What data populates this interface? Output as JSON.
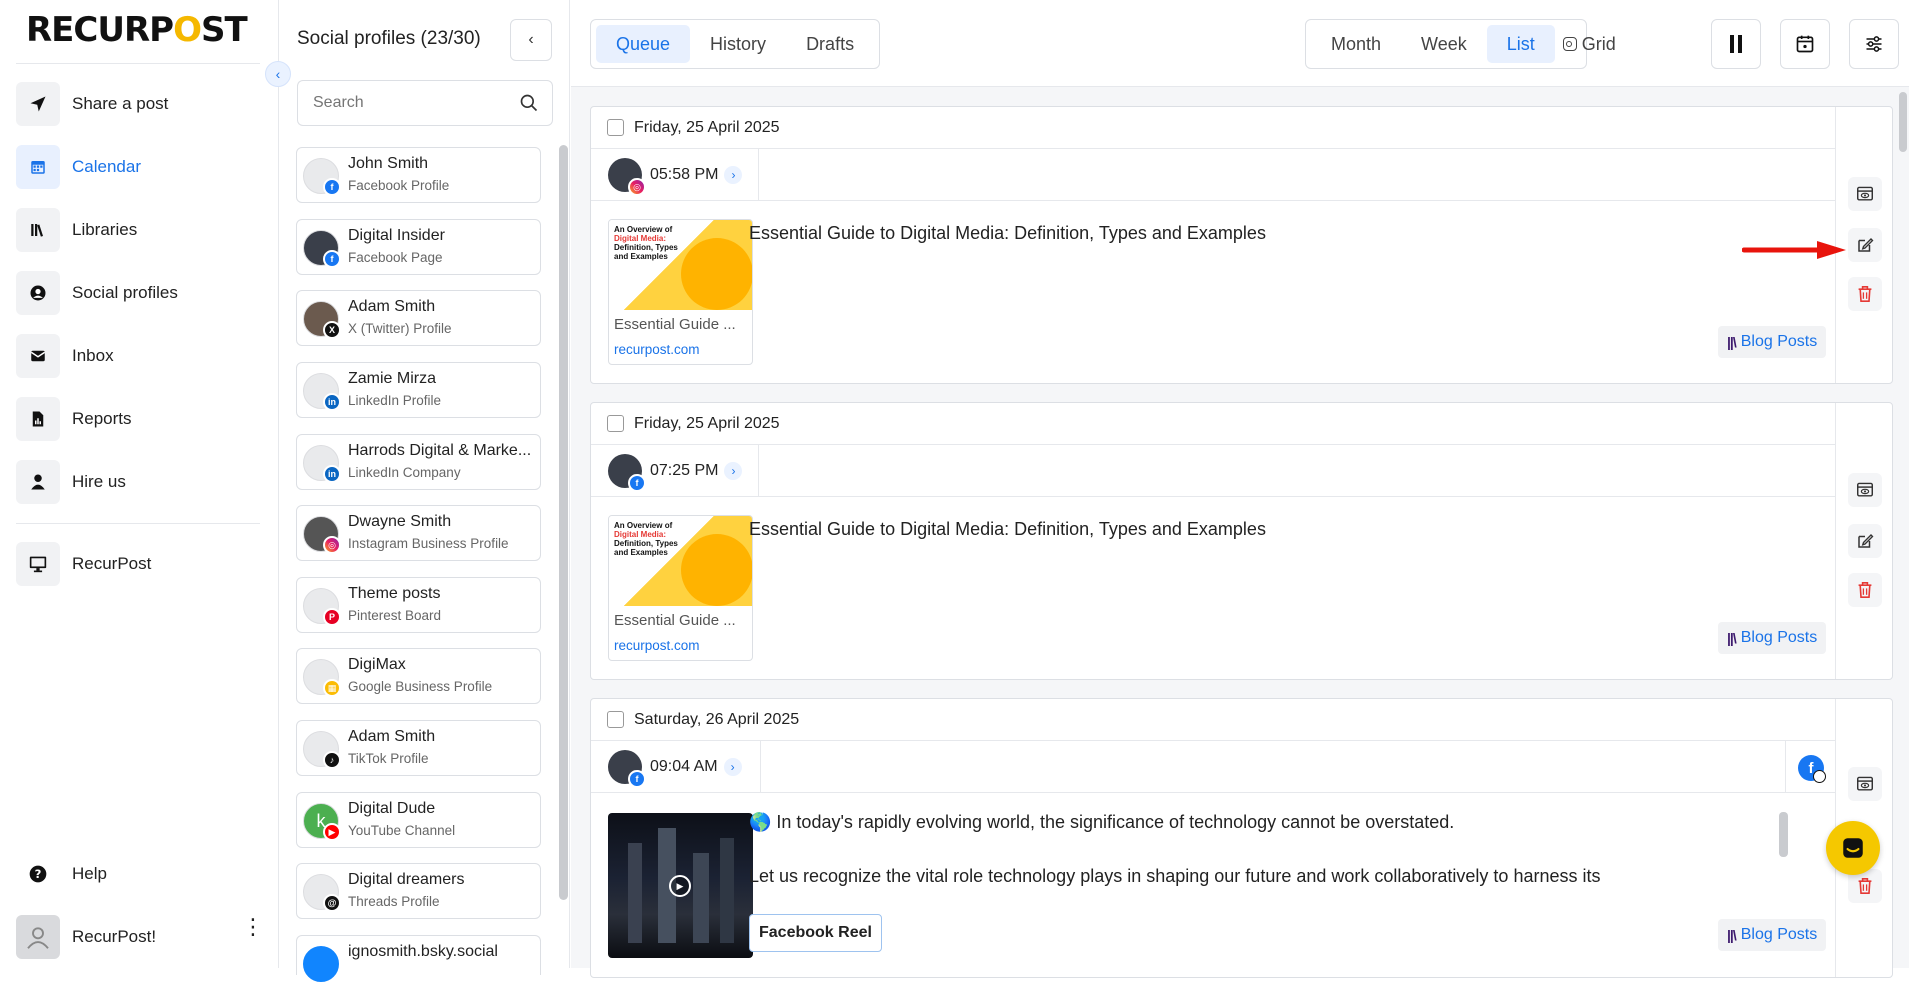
{
  "brand": {
    "logo_part1": "RECURP",
    "logo_o": "O",
    "logo_part2": "ST"
  },
  "nav": {
    "items": [
      {
        "label": "Share a post",
        "icon": "paper-plane-icon"
      },
      {
        "label": "Calendar",
        "icon": "calendar-icon"
      },
      {
        "label": "Libraries",
        "icon": "libraries-icon"
      },
      {
        "label": "Social profiles",
        "icon": "user-circle-icon"
      },
      {
        "label": "Inbox",
        "icon": "inbox-icon"
      },
      {
        "label": "Reports",
        "icon": "report-icon"
      },
      {
        "label": "Hire us",
        "icon": "person-icon"
      }
    ],
    "workspace": "RecurPost",
    "help": "Help",
    "user": "RecurPost!"
  },
  "profiles": {
    "title": "Social profiles (23/30)",
    "search_placeholder": "Search",
    "list": [
      {
        "name": "John Smith",
        "type": "Facebook Profile",
        "network": "facebook"
      },
      {
        "name": "Digital Insider",
        "type": "Facebook Page",
        "network": "facebook"
      },
      {
        "name": "Adam Smith",
        "type": "X (Twitter) Profile",
        "network": "x"
      },
      {
        "name": "Zamie Mirza",
        "type": "LinkedIn Profile",
        "network": "linkedin"
      },
      {
        "name": "Harrods Digital & Marke...",
        "type": "LinkedIn Company",
        "network": "linkedin"
      },
      {
        "name": "Dwayne Smith",
        "type": "Instagram Business Profile",
        "network": "instagram"
      },
      {
        "name": "Theme posts",
        "type": "Pinterest Board",
        "network": "pinterest"
      },
      {
        "name": "DigiMax",
        "type": "Google Business Profile",
        "network": "google"
      },
      {
        "name": "Adam Smith",
        "type": "TikTok Profile",
        "network": "tiktok"
      },
      {
        "name": "Digital Dude",
        "type": "YouTube Channel",
        "network": "youtube",
        "avatar_letter": "k"
      },
      {
        "name": "Digital dreamers",
        "type": "Threads Profile",
        "network": "threads"
      },
      {
        "name": "ignosmith.bsky.social",
        "type": "",
        "network": "bluesky"
      }
    ]
  },
  "toolbar": {
    "tabs": [
      "Queue",
      "History",
      "Drafts"
    ],
    "views": [
      "Month",
      "Week",
      "List",
      "Grid"
    ]
  },
  "posts": [
    {
      "date": "Friday, 25 April 2025",
      "time": "05:58 PM",
      "network": "instagram",
      "title": "Essential Guide to Digital Media: Definition, Types and Examples",
      "thumb_caption": "Essential Guide ...",
      "thumb_source": "recurpost.com",
      "thumb_heading_a": "An Overview of ",
      "thumb_heading_b": "Digital Media:",
      "thumb_heading_c": " Definition, Types and Examples",
      "tag": "Blog Posts"
    },
    {
      "date": "Friday, 25 April 2025",
      "time": "07:25 PM",
      "network": "facebook",
      "title": "Essential Guide to Digital Media: Definition, Types and Examples",
      "thumb_caption": "Essential Guide ...",
      "thumb_source": "recurpost.com",
      "thumb_heading_a": "An Overview of ",
      "thumb_heading_b": "Digital Media:",
      "thumb_heading_c": " Definition, Types and Examples",
      "tag": "Blog Posts"
    },
    {
      "date": "Saturday, 26 April 2025",
      "time": "09:04 AM",
      "network": "facebook",
      "line1": "🌎 In today's rapidly evolving world, the significance of technology cannot be overstated.",
      "line2": "Let us recognize the vital role technology plays in shaping our future and work collaboratively to harness its",
      "post_type": "Facebook Reel",
      "tag": "Blog Posts"
    }
  ],
  "colors": {
    "accent": "#1a73e8",
    "brand_yellow": "#f5b800",
    "delete": "#e53935",
    "arrow": "#e8140c"
  }
}
